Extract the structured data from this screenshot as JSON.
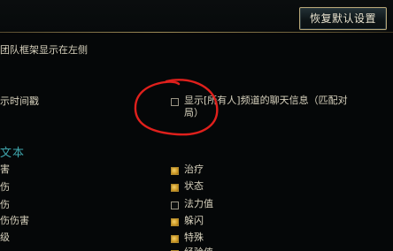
{
  "header": {
    "restore_button": "恢复默认设置"
  },
  "left_options": {
    "party_frames": "团队框架显示在左侧",
    "timestamps": "示时间戳"
  },
  "all_chat": {
    "line1": "显示[所有人]频道的聊天信息（匹配对",
    "line2": "局）",
    "checked": false
  },
  "section": {
    "title": "文本"
  },
  "left_list": [
    "害",
    "伤",
    "伤",
    "伤伤害",
    "级"
  ],
  "right_list": [
    {
      "label": "治疗",
      "checked": true
    },
    {
      "label": "状态",
      "checked": true
    },
    {
      "label": "法力值",
      "checked": false
    },
    {
      "label": "躲闪",
      "checked": true
    },
    {
      "label": "特殊",
      "checked": true
    },
    {
      "label": "经验值",
      "checked": true
    }
  ],
  "colors": {
    "background": "#050708",
    "section_title": "#3fa6ad",
    "checked_gold": "#d9a83a",
    "annotation_red": "#e0201c",
    "button_border": "#b7a677"
  },
  "icons": {
    "checkbox_checked": "checked-gold-square",
    "checkbox_unchecked": "empty-square"
  }
}
